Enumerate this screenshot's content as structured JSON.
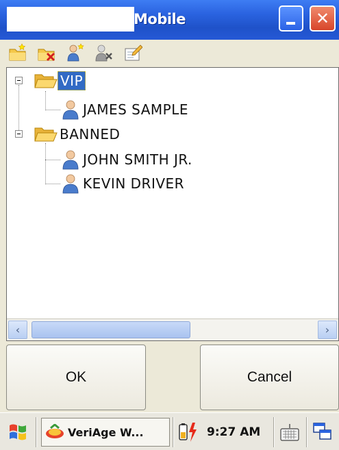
{
  "window": {
    "title": "Mobile"
  },
  "titlebar": {
    "close_glyph": "✕"
  },
  "toolbar": {
    "icons": [
      "new-folder-icon",
      "delete-folder-icon",
      "add-person-icon",
      "remove-person-icon",
      "edit-icon"
    ]
  },
  "tree": {
    "groups": [
      {
        "label": "VIP",
        "selected": true,
        "members": [
          "JAMES SAMPLE"
        ]
      },
      {
        "label": "BANNED",
        "selected": false,
        "members": [
          "JOHN SMITH JR.",
          "KEVIN DRIVER"
        ]
      }
    ]
  },
  "scrollbar": {
    "left_glyph": "‹",
    "right_glyph": "›"
  },
  "buttons": {
    "ok_label": "OK",
    "cancel_label": "Cancel"
  },
  "taskbar": {
    "app_label": "VeriAge W...",
    "clock": "9:27 AM"
  },
  "colors": {
    "titlebar": "#2a63e0",
    "selection": "#316ac5",
    "close_button": "#d8462a"
  }
}
